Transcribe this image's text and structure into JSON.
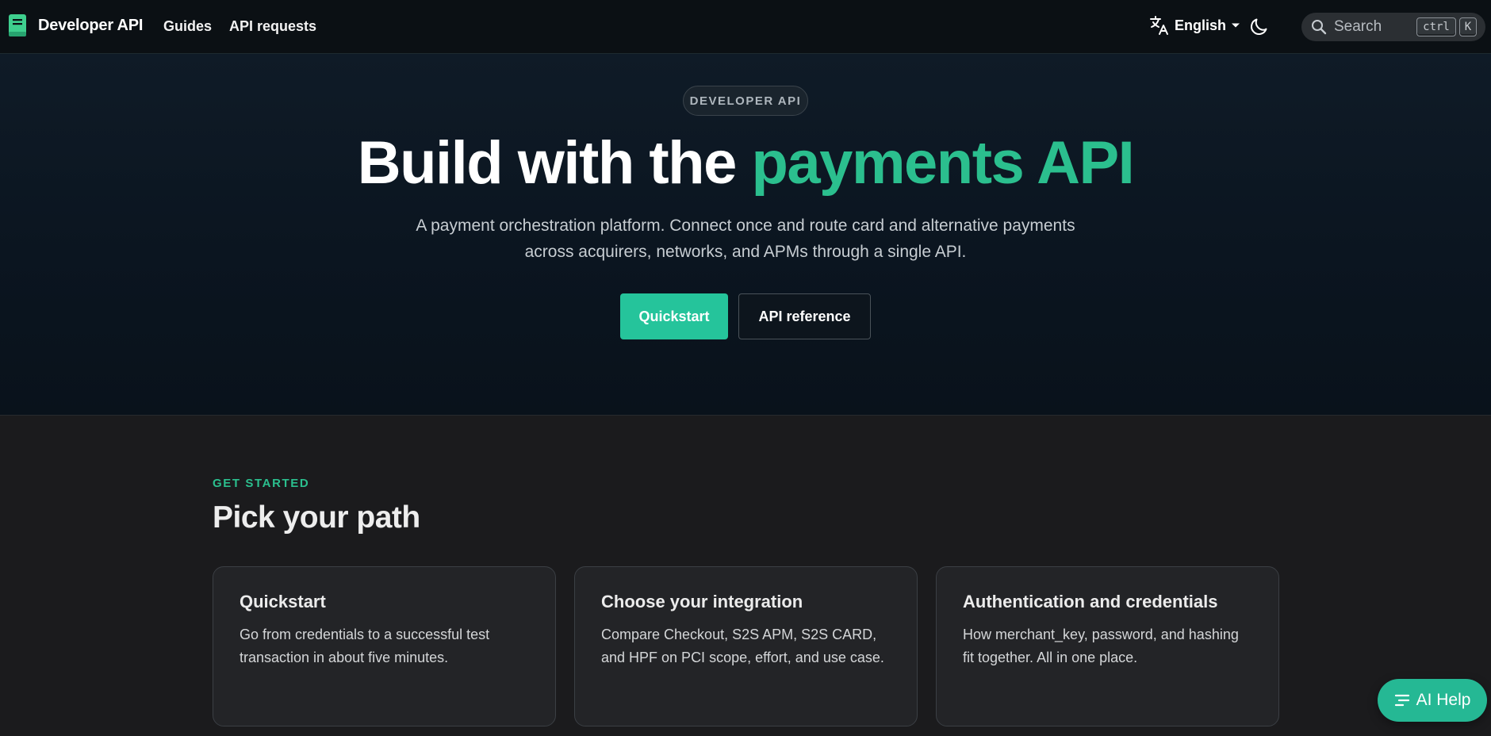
{
  "navbar": {
    "brand_title": "Developer API",
    "links": [
      "Guides",
      "API requests"
    ],
    "language": "English",
    "search": {
      "label": "Search",
      "shortcut_keys": [
        "ctrl",
        "K"
      ]
    },
    "icons": [
      "book-logo-icon",
      "translate-icon",
      "chevron-down-icon",
      "moon-icon",
      "search-icon"
    ]
  },
  "hero": {
    "badge": "DEVELOPER API",
    "title_plain": "Build with the ",
    "title_accent": "payments API",
    "subtitle": "A payment orchestration platform. Connect once and route card and alternative payments across acquirers, networks, and APMs through a single API.",
    "primary_button": "Quickstart",
    "secondary_button": "API reference"
  },
  "get_started": {
    "eyebrow": "GET STARTED",
    "title": "Pick your path",
    "cards": [
      {
        "title": "Quickstart",
        "description": "Go from credentials to a successful test transaction in about five minutes."
      },
      {
        "title": "Choose your integration",
        "description": "Compare Checkout, S2S APM, S2S CARD, and HPF on PCI scope, effort, and use case."
      },
      {
        "title": "Authentication and credentials",
        "description": "How merchant_key, password, and hashing fit together. All in one place."
      }
    ]
  },
  "ai_help": {
    "label": "AI Help",
    "icon": "list-icon"
  },
  "colors": {
    "accent": "#2bbf8e",
    "primary_button": "#25c49b",
    "navbar_bg": "#0b1014",
    "hero_bg": "#0f1b27",
    "page_bg": "#1b1b1d"
  }
}
